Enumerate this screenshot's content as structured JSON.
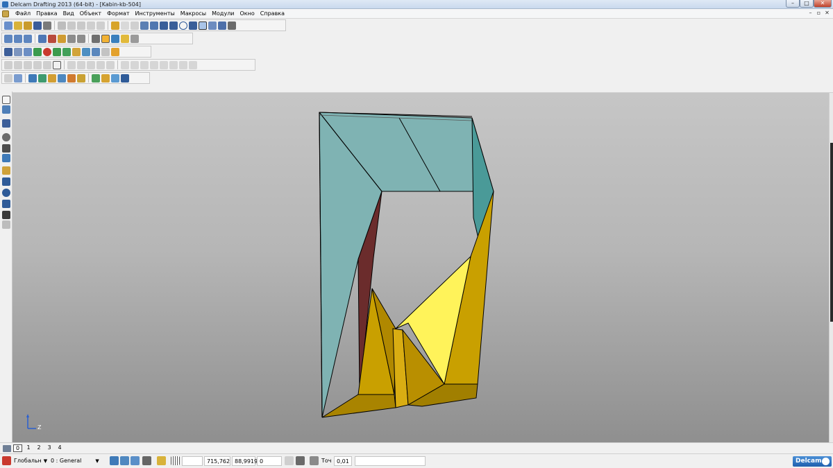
{
  "window": {
    "title": "Delcam Drafting 2013 (64-bit) - [Kabin-kb-504]",
    "controls": {
      "minimize": "–",
      "maximize": "□",
      "close": "✕"
    }
  },
  "menu": {
    "items": [
      "Файл",
      "Правка",
      "Вид",
      "Объект",
      "Формат",
      "Инструменты",
      "Макросы",
      "Модули",
      "Окно",
      "Справка"
    ],
    "mdi_controls": {
      "minimize": "–",
      "restore": "▫",
      "close": "✕"
    }
  },
  "toolbars": [
    {
      "icons": [
        "new-file-icon",
        "open-icon",
        "open-model-icon",
        "save-icon",
        "print-icon",
        "cut-icon",
        "copy-icon",
        "paste-icon",
        "erase-icon",
        "delete-icon",
        "undo-icon",
        "redo-icon",
        "text-icon",
        "rectangle-icon",
        "polyline-icon",
        "line-icon",
        "arc-icon",
        "circle-icon",
        "curve-icon",
        "annotate-icon",
        "hatch-icon",
        "fill-icon",
        "table-icon"
      ]
    },
    {
      "icons": [
        "view-top-icon",
        "view-front-icon",
        "view-side-icon",
        "view-iso-icon",
        "view-rotate-icon",
        "zoom-icon",
        "zoom-in-icon",
        "zoom-out-icon",
        "globe-icon",
        "shaded-icon",
        "render-icon",
        "light-icon",
        "settings-icon"
      ]
    },
    {
      "icons": [
        "wire-icon",
        "sheet-icon",
        "drawing-icon",
        "model-green-icon",
        "model-red-icon",
        "arrow-right-icon",
        "arrow-green-icon",
        "block-icon",
        "frame-icon",
        "section-icon",
        "layer-icon",
        "group-icon"
      ]
    },
    {
      "icons": [
        "edit-1-icon",
        "edit-2-icon",
        "edit-3-icon",
        "edit-4-icon",
        "edit-5-icon",
        "select-box-icon",
        "trim-icon",
        "extend-icon",
        "offset-icon",
        "mirror-icon",
        "scale-icon",
        "curve-1-icon",
        "curve-2-icon",
        "curve-3-icon",
        "curve-4-icon",
        "curve-5-icon",
        "curve-6-icon",
        "curve-7-icon",
        "curve-8-icon"
      ]
    },
    {
      "icons": [
        "select-icon",
        "dimension-x-icon",
        "solid-1-icon",
        "solid-2-icon",
        "solid-3-icon",
        "solid-4-icon",
        "solid-5-icon",
        "solid-6-icon",
        "assembly-icon",
        "mesh-icon",
        "shade-icon",
        "wedge-icon"
      ]
    }
  ],
  "left_toolbar": {
    "icons": [
      "pointer-icon",
      "layers-icon",
      "text-style-icon",
      "magnifier-icon",
      "pencil-icon",
      "move-icon",
      "anchor-icon",
      "wrench-icon",
      "rotate-icon",
      "triangle-icon",
      "dimension-icon",
      "table-small-icon"
    ]
  },
  "viewport": {
    "axis_label": "Z",
    "colors": {
      "frame": "#7fb3b3",
      "frame_dark": "#4a9a98",
      "yellow": "#c9a000",
      "yellow_light": "#fff35a",
      "maroon": "#6b2c2c"
    }
  },
  "page_tabs": {
    "items": [
      "0",
      "1",
      "2",
      "3",
      "4"
    ],
    "active": "0"
  },
  "statusbar": {
    "level_label": "Глобальн",
    "layer_value": "0",
    "layer_name": ": General",
    "x": "715,762",
    "y": "88,9919",
    "z": "0",
    "snap_label": "Точ",
    "snap_value": "0,01",
    "brand": "Delcam"
  }
}
